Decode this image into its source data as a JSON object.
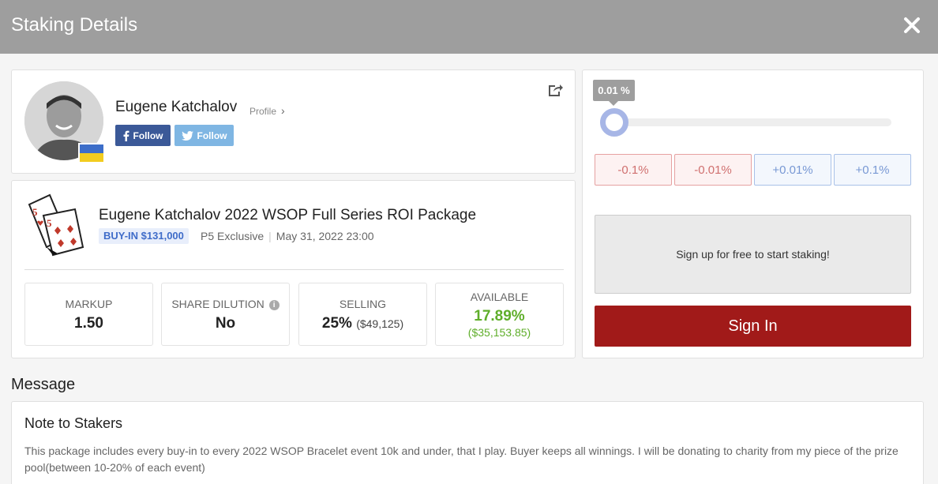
{
  "header": {
    "title": "Staking Details"
  },
  "profile": {
    "name": "Eugene Katchalov",
    "profile_link": "Profile",
    "facebook_follow": "Follow",
    "twitter_follow": "Follow"
  },
  "package": {
    "title": "Eugene Katchalov 2022 WSOP Full Series ROI Package",
    "buyin": "BUY-IN $131,000",
    "exclusive": "P5 Exclusive",
    "date": "May 31, 2022 23:00",
    "stats": {
      "markup_label": "MARKUP",
      "markup_value": "1.50",
      "dilution_label": "SHARE DILUTION",
      "dilution_value": "No",
      "selling_label": "SELLING",
      "selling_value": "25%",
      "selling_amount": "($49,125)",
      "available_label": "AVAILABLE",
      "available_value": "17.89%",
      "available_amount": "($35,153.85)"
    }
  },
  "stake": {
    "slider_label": "0.01 %",
    "slider_fraction": 0.0004,
    "buttons": [
      "-0.1%",
      "-0.01%",
      "+0.01%",
      "+0.1%"
    ],
    "signup_text": "Sign up for free to start staking!",
    "signin_label": "Sign In"
  },
  "message": {
    "heading": "Message",
    "note_title": "Note to Stakers",
    "note_body": "This package includes every buy-in to every 2022 WSOP Bracelet event 10k and under, that I play. Buyer keeps all winnings. I will be donating to charity from my piece of the prize pool(between 10-20% of each event)"
  },
  "colors": {
    "header_bg": "#9e9e9e",
    "signin_bg": "#a11a19",
    "available_green": "#5fae2a",
    "buyin_blue": "#3f6cc9"
  }
}
